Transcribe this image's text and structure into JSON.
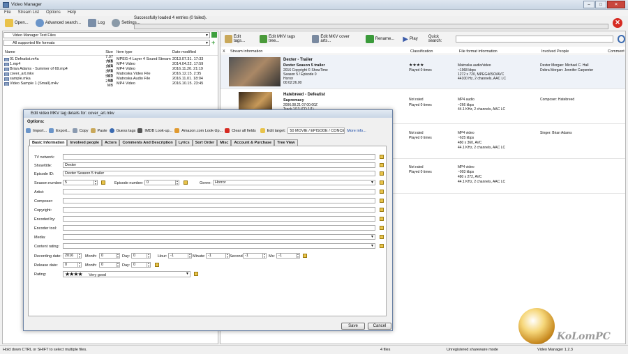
{
  "window": {
    "title": "Video Manager",
    "close": "✕",
    "min": "–",
    "max": "□"
  },
  "menu": [
    "File",
    "Stream List",
    "Options",
    "Help"
  ],
  "toolbar": {
    "open": "Open...",
    "advanced_search": "Advanced search...",
    "log": "Log",
    "settings": "Settings..."
  },
  "status_message": "Successfully loaded 4 entries (0 failed).",
  "left": {
    "folder": "Video Manager Test Files",
    "format": "All supported file formats",
    "columns": [
      "Name",
      "Size",
      "Item type",
      "Date modified"
    ],
    "files": [
      {
        "name": "01 Defeatist.m4a",
        "size": "7.07 MB",
        "type": "MPEG-4 Layer 4 Sound Stream",
        "date": "2013.07.31. 17:33"
      },
      {
        "name": "1.mp4",
        "size": "79.5 MB",
        "type": "MP4 Video",
        "date": "2014.04.22. 17:59"
      },
      {
        "name": "Brian Adams - Summer of 69.mp4",
        "size": "16.4 MB",
        "type": "MP4 Video",
        "date": "2016.11.20. 21:19"
      },
      {
        "name": "cover_art.mkv",
        "size": "37.6 MB",
        "type": "Matroska Video File",
        "date": "2016.12.15. 2:35"
      },
      {
        "name": "sample.mka",
        "size": "56.1 KB",
        "type": "Matroska Audio File",
        "date": "2016.11.01. 18:04"
      },
      {
        "name": "Video Sample 1 (Small).m4v",
        "size": "2.48 MB",
        "type": "MP4 Video",
        "date": "2016.10.15. 23:45"
      }
    ]
  },
  "right": {
    "toolbar": {
      "edit_tags": "Edit tags...",
      "edit_mkv_tree": "Edit MKV tags tree...",
      "edit_cover": "Edit MKV cover arts...",
      "rename": "Rename...",
      "play": "Play",
      "quick_search": "Quick search:"
    },
    "columns": [
      "X",
      "Stream information",
      "Classification",
      "File format information",
      "Involved People",
      "Comment"
    ],
    "rows": [
      {
        "title": "Dexter - Trailer",
        "subtitle": "Dexter Season 5 trailer",
        "lines": [
          "2016 Copyright © ShowTime",
          "Season 5 / Episode 0",
          "Horror",
          "00:02:26.00"
        ],
        "rating": "★★★★",
        "played": "Played 0 times",
        "format": [
          "Matroska audio/video",
          "~1968 kbps",
          "1272 x 720, MPEG4/ISO/AVC",
          "44100 Hz, 2 channels, AAC LC"
        ],
        "people": [
          "Dexter Morgan: Michael C. Hall",
          "Debra Morgan: Jennifer Carpenter"
        ]
      },
      {
        "title": "Hatebreed - Defeatist",
        "subtitle": "Supremacy",
        "lines": [
          "2006.08.21 07:00:00Z",
          "Track 1/13 (CD 1/1)"
        ],
        "rating": "Not rated",
        "played": "Played 0 times",
        "format": [
          "MP4 audio",
          "~266 kbps",
          "44.1 KHz, 2 channels, AAC LC"
        ],
        "people": [
          "Composer: Hatebreed"
        ]
      },
      {
        "title": "",
        "subtitle": "",
        "lines": [],
        "rating": "Not rated",
        "played": "Played 0 times",
        "format": [
          "MP4 video",
          "~625 kbps",
          "480 x 360, AVC",
          "44.1 KHz, 2 channels, AAC LC"
        ],
        "people": [
          "Singer: Brian Adams"
        ]
      },
      {
        "title": "",
        "subtitle": "",
        "lines": [],
        "rating": "Not rated",
        "played": "Played 0 times",
        "format": [
          "MP4 video",
          "~903 kbps",
          "480 x 272, AVC",
          "44.1 KHz, 2 channels, AAC LC"
        ],
        "people": []
      }
    ]
  },
  "dialog": {
    "title": "Edit video MKV tag details for: cover_art.mkv",
    "options": "Options:",
    "tools": [
      "Import...",
      "Export...",
      "Copy",
      "Paste",
      "Guess tags",
      "IMDB Look-up...",
      "Amazon.com Look-Up...",
      "Clear all fields"
    ],
    "edit_target_label": "Edit target:",
    "edit_target_value": "50 MOVIE / EPISODE / CONCERT",
    "more_info": "More info...",
    "tabs": [
      "Basic Information",
      "Involved people",
      "Actors",
      "Comments And Description",
      "Lyrics",
      "Sort Order",
      "Misc",
      "Account & Purchase",
      "Tree View"
    ],
    "fields": {
      "tv_network": {
        "label": "TV network:",
        "value": ""
      },
      "show_title": {
        "label": "Show/title:",
        "value": "Dexter"
      },
      "episode_id": {
        "label": "Episode ID:",
        "value": "Dexter Season 5 trailer"
      },
      "season_number": {
        "label": "Season number:",
        "value": "5"
      },
      "episode_number": {
        "label": "Episode number:",
        "value": "0"
      },
      "genre": {
        "label": "Genre:",
        "value": "Horror"
      },
      "artist": {
        "label": "Artist:"
      },
      "composer": {
        "label": "Composer:"
      },
      "copyright": {
        "label": "Copyright:"
      },
      "encoded_by": {
        "label": "Encoded by:"
      },
      "encoder_tool": {
        "label": "Encoder tool:"
      },
      "media": {
        "label": "Media:"
      },
      "content_rating": {
        "label": "Content rating:"
      },
      "recording_date": {
        "label": "Recording date:",
        "year": "2016",
        "month_label": "Month:",
        "month": "0",
        "day_label": "Day:",
        "day": "0",
        "hour_label": "Hour:",
        "hour": "-1",
        "minute_label": "Minute:",
        "minute": "-1",
        "second_label": "Second:",
        "second": "-1",
        "ms_label": "Ms:",
        "ms": "-1"
      },
      "release_date": {
        "label": "Release date:",
        "year": "0",
        "month_label": "Month:",
        "month": "0",
        "day_label": "Day:",
        "day": "0"
      },
      "rating": {
        "label": "Rating:",
        "stars": "★★★★",
        "text": "Very good"
      }
    },
    "save": "Save",
    "cancel": "Cancel"
  },
  "statusbar": {
    "hint": "Hold down CTRL or SHIFT to select multiple files.",
    "count": "4 files",
    "license": "Unregistered shareware mode",
    "version": "Video Manager 1.2.3"
  },
  "watermark": "KoLomPC",
  "colors": {
    "accent": "#5a7fb0",
    "error": "#d62b22",
    "pencil": "#e8c34a"
  }
}
